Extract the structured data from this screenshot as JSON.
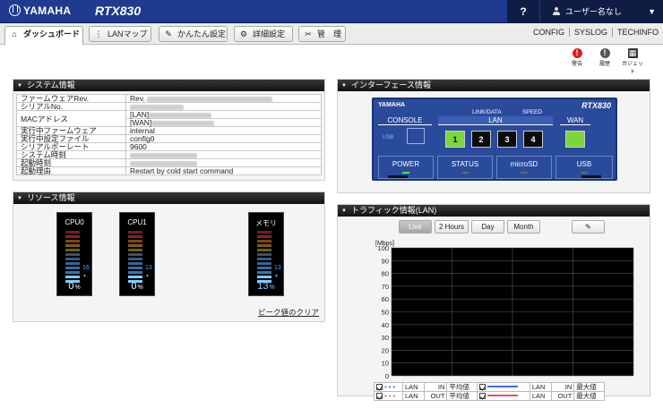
{
  "header": {
    "brand": "YAMAHA",
    "model": "RTX830",
    "help": "?",
    "user": "ユーザー名なし",
    "caret": "▼"
  },
  "nav": {
    "tabs": [
      {
        "label": "ダッシュボード",
        "icon": "home-icon",
        "glyph": "⌂"
      },
      {
        "label": "LANマップ",
        "icon": "lan-map-icon",
        "glyph": "⋮"
      },
      {
        "label": "かんたん設定",
        "icon": "wand-icon",
        "glyph": "✎"
      },
      {
        "label": "詳細設定",
        "icon": "gear-icon",
        "glyph": "⚙"
      },
      {
        "label": "管　理",
        "icon": "wrench-icon",
        "glyph": "✂"
      }
    ],
    "links": [
      "CONFIG",
      "SYSLOG",
      "TECHINFO"
    ]
  },
  "status_icons": [
    {
      "label": "警告",
      "glyph": "!",
      "color": "#e01b1b"
    },
    {
      "label": "履歴",
      "glyph": "!",
      "color": "#555555"
    },
    {
      "label": "ガジェット",
      "glyph": "▦",
      "color": "#333333"
    }
  ],
  "system": {
    "title": "システム情報",
    "rows": [
      {
        "key": "ファームウェアRev.",
        "value": "Rev."
      },
      {
        "key": "シリアルNo.",
        "value": ""
      },
      {
        "key": "MACアドレス",
        "value": "[LAN]"
      },
      {
        "key": "",
        "value": "[WAN]"
      },
      {
        "key": "実行中ファームウェア",
        "value": "internal"
      },
      {
        "key": "実行中設定ファイル",
        "value": "config0"
      },
      {
        "key": "シリアルボーレート",
        "value": "9600"
      },
      {
        "key": "システム時刻",
        "value": ""
      },
      {
        "key": "起動時刻",
        "value": ""
      },
      {
        "key": "起動理由",
        "value": "Restart by cold start command"
      }
    ]
  },
  "resource": {
    "title": "リソース情報",
    "gauges": [
      {
        "name": "CPU0",
        "value": "0",
        "unit": "%",
        "peak": "16",
        "level": 0.16
      },
      {
        "name": "CPU1",
        "value": "0",
        "unit": "%",
        "peak": "13",
        "level": 0.13
      },
      {
        "name": "メモリ",
        "value": "13",
        "unit": "%",
        "peak": "13",
        "level": 0.13
      }
    ],
    "clear_label": "ピーク値のクリア"
  },
  "interface": {
    "title": "インターフェース情報",
    "device_brand": "YAMAHA",
    "device_model": "RTX830",
    "console": "CONSOLE",
    "usb_small": "USB",
    "linkdata": "LINK/DATA",
    "speed": "SPEED",
    "lan": "LAN",
    "wan": "WAN",
    "ports": [
      "1",
      "2",
      "3",
      "4"
    ],
    "port_link": [
      true,
      false,
      false,
      false
    ],
    "wan_link": true,
    "leds": [
      {
        "label": "POWER",
        "on": true
      },
      {
        "label": "STATUS",
        "on": false
      },
      {
        "label": "microSD",
        "on": false
      },
      {
        "label": "USB",
        "on": false
      }
    ]
  },
  "traffic": {
    "title": "トラフィック情報(LAN)",
    "buttons": [
      "Live",
      "2 Hours",
      "Day",
      "Month"
    ],
    "active_button": "Live",
    "edit_icon": "pencil-icon",
    "legend": [
      [
        "LAN",
        "IN",
        "平均値",
        "LAN",
        "IN",
        "最大値"
      ],
      [
        "LAN",
        "OUT",
        "平均値",
        "LAN",
        "OUT",
        "最大値"
      ]
    ],
    "legend_colors": [
      "#3a6cf0",
      "#e0506c"
    ]
  },
  "chart_data": {
    "type": "line",
    "ylabel": "[Mbps]",
    "ylim": [
      0,
      100
    ],
    "yticks": [
      0,
      10,
      20,
      30,
      40,
      50,
      60,
      70,
      80,
      90,
      100
    ],
    "series": [],
    "grid": true
  }
}
